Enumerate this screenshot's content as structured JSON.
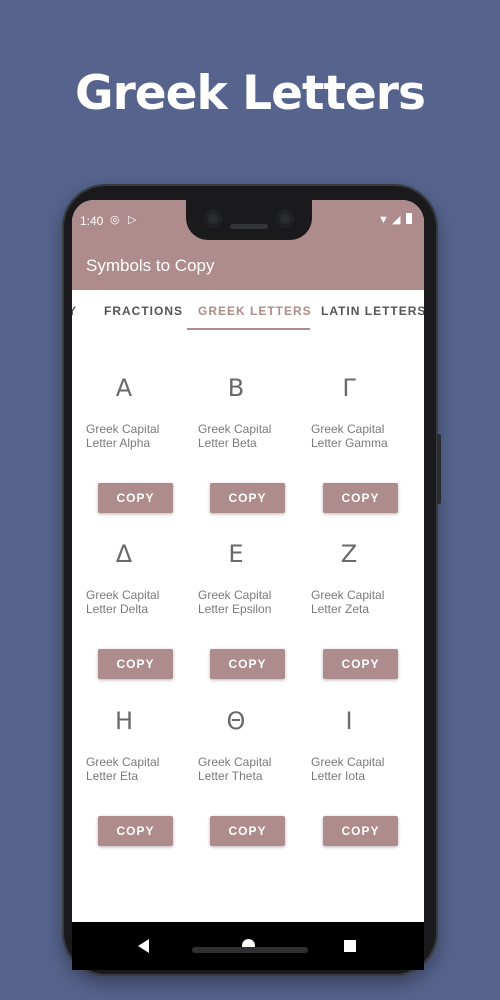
{
  "promo": {
    "title": "Greek Letters"
  },
  "status_bar": {
    "time": "1:40"
  },
  "app": {
    "title": "Symbols to Copy"
  },
  "tabs": [
    {
      "label": "Y"
    },
    {
      "label": "FRACTIONS"
    },
    {
      "label": "GREEK LETTERS",
      "active": true
    },
    {
      "label": "LATIN LETTERS"
    }
  ],
  "cards": [
    {
      "symbol": "Α",
      "name_line1": "Greek Capital",
      "name_line2": "Letter Alpha",
      "button": "COPY"
    },
    {
      "symbol": "Β",
      "name_line1": "Greek Capital",
      "name_line2": "Letter Beta",
      "button": "COPY"
    },
    {
      "symbol": "Γ",
      "name_line1": "Greek Capital",
      "name_line2": "Letter Gamma",
      "button": "COPY"
    },
    {
      "symbol": "Δ",
      "name_line1": "Greek Capital",
      "name_line2": "Letter Delta",
      "button": "COPY"
    },
    {
      "symbol": "Ε",
      "name_line1": "Greek Capital",
      "name_line2": "Letter Epsilon",
      "button": "COPY"
    },
    {
      "symbol": "Ζ",
      "name_line1": "Greek Capital",
      "name_line2": "Letter Zeta",
      "button": "COPY"
    },
    {
      "symbol": "Η",
      "name_line1": "Greek Capital",
      "name_line2": "Letter Eta",
      "button": "COPY"
    },
    {
      "symbol": "Θ",
      "name_line1": "Greek Capital",
      "name_line2": "Letter Theta",
      "button": "COPY"
    },
    {
      "symbol": "Ι",
      "name_line1": "Greek Capital",
      "name_line2": "Letter Iota",
      "button": "COPY"
    }
  ],
  "colors": {
    "background": "#56648d",
    "accent": "#ae8b8d"
  },
  "icons": [
    "screen-record-icon",
    "cast-icon",
    "wifi-icon",
    "signal-icon",
    "battery-icon",
    "back-icon",
    "home-icon",
    "recents-icon"
  ]
}
